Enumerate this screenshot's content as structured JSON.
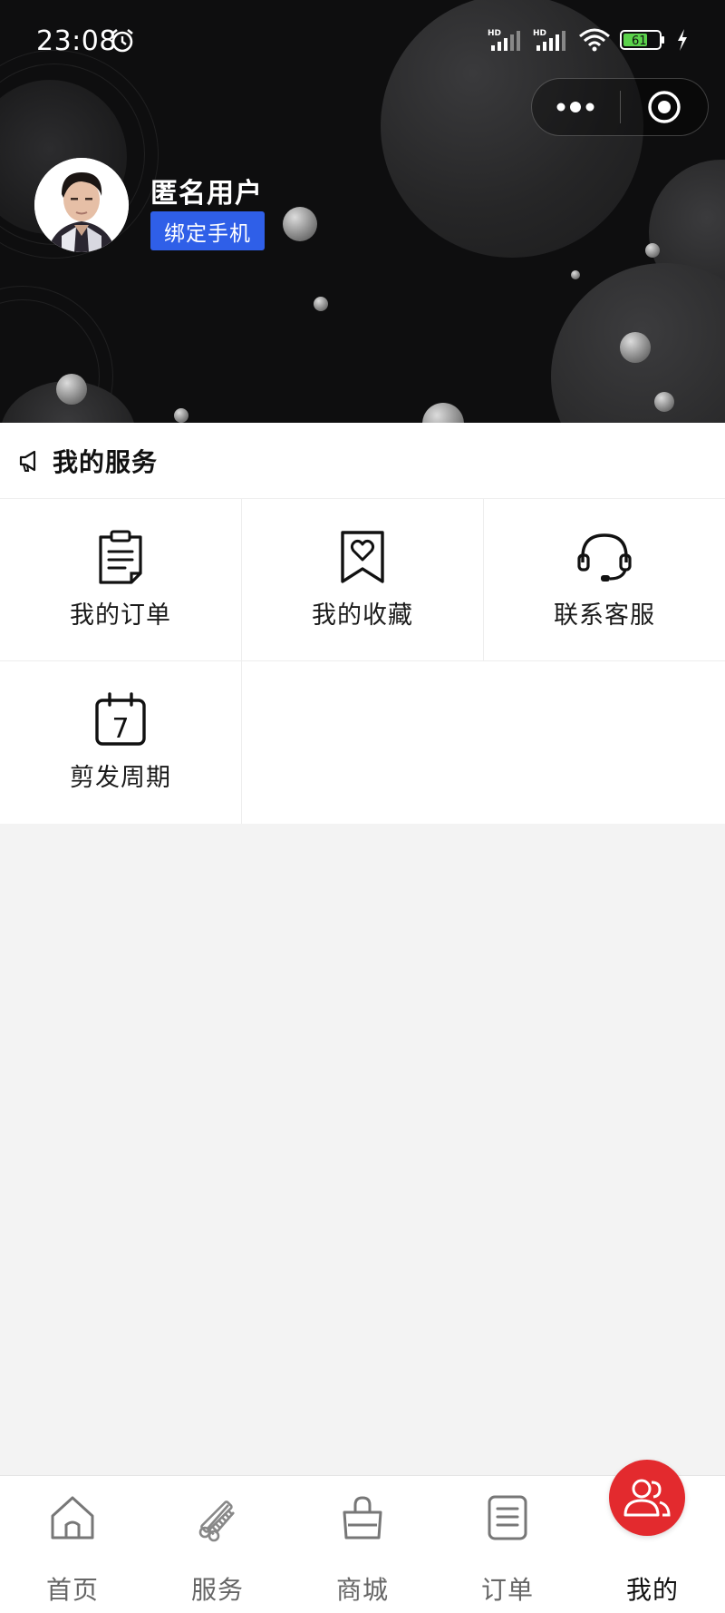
{
  "status_bar": {
    "time": "23:08",
    "battery": "61",
    "icons": [
      "alarm-icon",
      "signal-hd-icon",
      "signal-hd-icon",
      "wifi-icon",
      "battery-icon",
      "charging-icon"
    ]
  },
  "capsule": {
    "more_icon": "more-dots-icon",
    "close_icon": "target-circle-icon"
  },
  "user": {
    "name": "匿名用户",
    "bind_phone_label": "绑定手机"
  },
  "services": {
    "title": "我的服务",
    "title_icon": "megaphone-icon",
    "items": [
      {
        "label": "我的订单",
        "icon": "clipboard-icon"
      },
      {
        "label": "我的收藏",
        "icon": "bookmark-heart-icon"
      },
      {
        "label": "联系客服",
        "icon": "headset-icon"
      },
      {
        "label": "剪发周期",
        "icon": "calendar-7-icon",
        "icon_text": "7"
      }
    ]
  },
  "tabbar": {
    "items": [
      {
        "label": "首页",
        "icon": "home-icon"
      },
      {
        "label": "服务",
        "icon": "scissors-comb-icon"
      },
      {
        "label": "商城",
        "icon": "shopping-bag-icon"
      },
      {
        "label": "订单",
        "icon": "list-icon"
      },
      {
        "label": "我的",
        "icon": "users-icon",
        "active": true
      }
    ]
  },
  "colors": {
    "header_bg": "#0e0e0f",
    "bind_button": "#2f5fe8",
    "active_tab": "#e32a2e",
    "page_bg": "#f3f3f3"
  }
}
